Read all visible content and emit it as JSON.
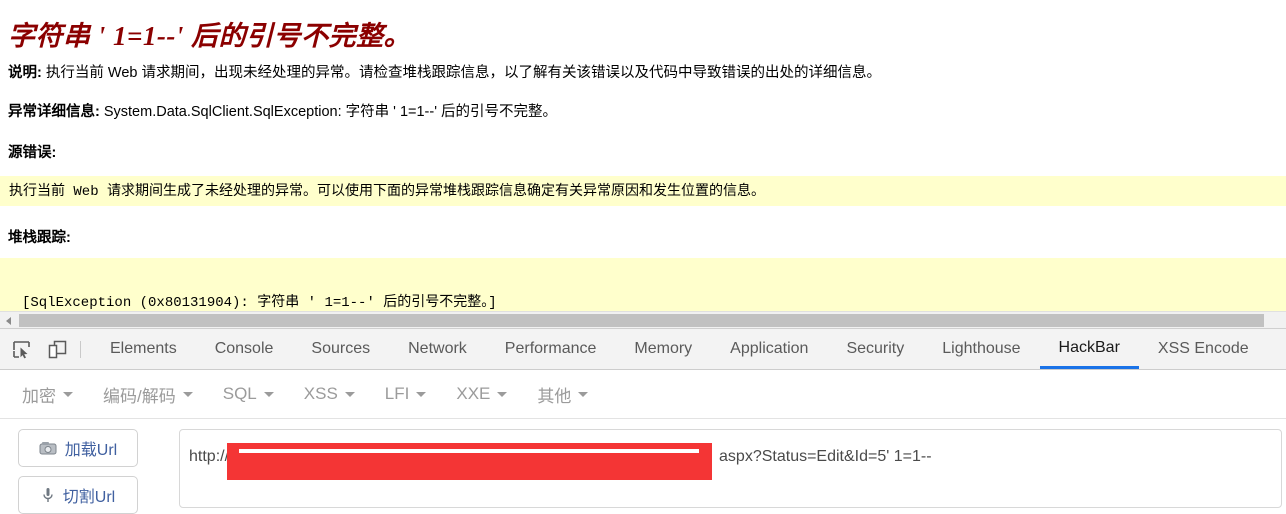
{
  "error_page": {
    "title": "字符串 ' 1=1--' 后的引号不完整。",
    "description_label": "说明:",
    "description_text": " 执行当前 Web 请求期间，出现未经处理的异常。请检查堆栈跟踪信息，以了解有关该错误以及代码中导致错误的出处的详细信息。",
    "exception_label": "异常详细信息:",
    "exception_text": " System.Data.SqlClient.SqlException: 字符串 ' 1=1--' 后的引号不完整。",
    "source_error_heading": "源错误:",
    "source_error_text": "执行当前 Web 请求期间生成了未经处理的异常。可以使用下面的异常堆栈跟踪信息确定有关异常原因和发生位置的信息。",
    "stack_trace_heading": "堆栈跟踪:",
    "stack_trace_text": "[SqlException (0x80131904): 字符串 ' 1=1--' 后的引号不完整。]",
    "colors": {
      "title": "#8b0000",
      "code_background": "#ffffcc"
    }
  },
  "devtools": {
    "icons": {
      "inspect": "inspect-element-icon",
      "device": "device-toolbar-icon"
    },
    "tabs": [
      {
        "label": "Elements",
        "active": false
      },
      {
        "label": "Console",
        "active": false
      },
      {
        "label": "Sources",
        "active": false
      },
      {
        "label": "Network",
        "active": false
      },
      {
        "label": "Performance",
        "active": false
      },
      {
        "label": "Memory",
        "active": false
      },
      {
        "label": "Application",
        "active": false
      },
      {
        "label": "Security",
        "active": false
      },
      {
        "label": "Lighthouse",
        "active": false
      },
      {
        "label": "HackBar",
        "active": true
      },
      {
        "label": "XSS Encode",
        "active": false
      }
    ],
    "active_tab": "HackBar",
    "accent_color": "#1a73e8"
  },
  "hackbar": {
    "menus": [
      {
        "label": "加密"
      },
      {
        "label": "编码/解码"
      },
      {
        "label": "SQL"
      },
      {
        "label": "XSS"
      },
      {
        "label": "LFI"
      },
      {
        "label": "XXE"
      },
      {
        "label": "其他"
      }
    ],
    "buttons": [
      {
        "label": "加载Url",
        "icon": "load-url-icon"
      },
      {
        "label": "切割Url",
        "icon": "split-url-icon"
      }
    ],
    "url_field": {
      "prefix": "http://",
      "suffix": "aspx?Status=Edit&Id=5' 1=1--",
      "redacted": true,
      "redaction_color": "#f43535"
    }
  }
}
